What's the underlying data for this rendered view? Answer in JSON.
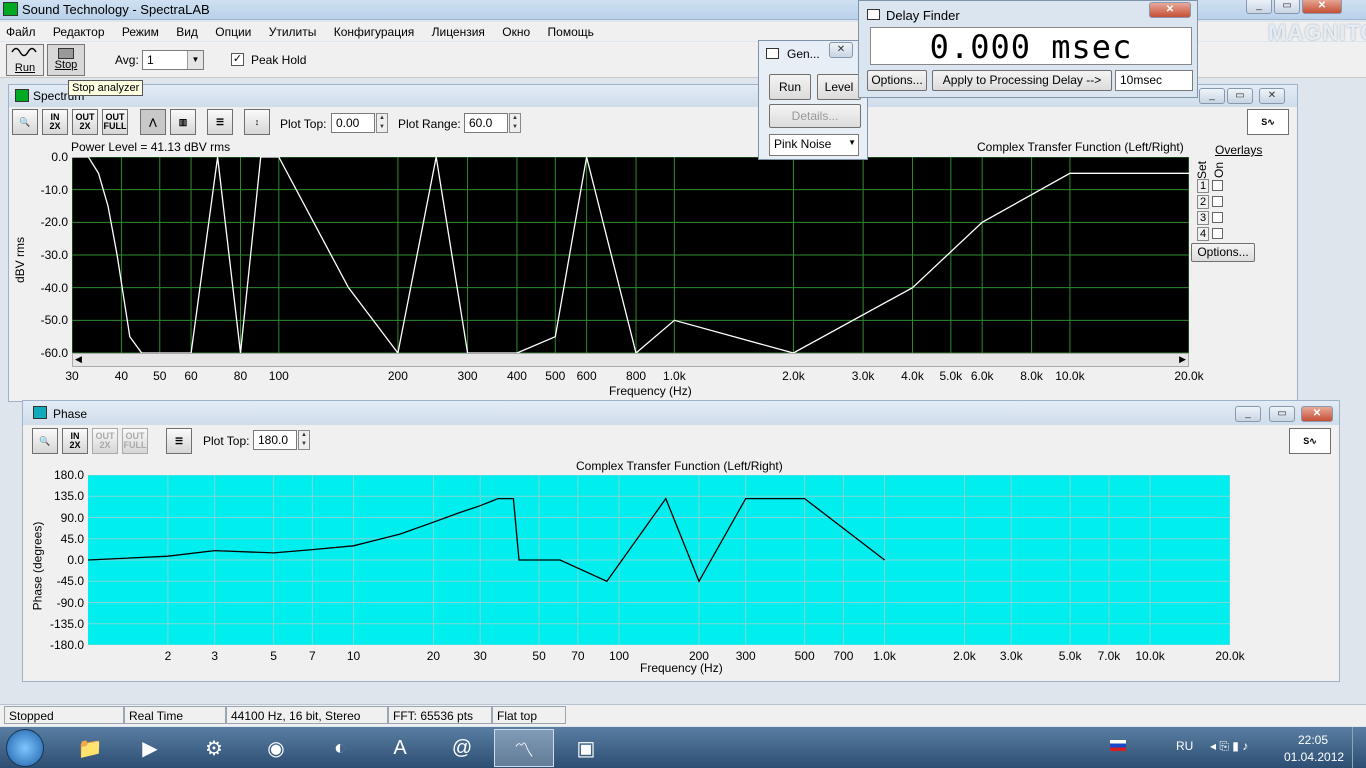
{
  "app": {
    "title": "Sound Technology - SpectraLAB",
    "menu": [
      "Файл",
      "Редактор",
      "Режим",
      "Вид",
      "Опции",
      "Утилиты",
      "Конфигурация",
      "Лицензия",
      "Окно",
      "Помощь"
    ]
  },
  "toolbar": {
    "run_label": "Run",
    "stop_label": "Stop",
    "avg_label": "Avg:",
    "avg_value": "1",
    "peak_hold_label": "Peak Hold",
    "peak_hold_checked": true,
    "tooltip": "Stop analyzer"
  },
  "spectrum": {
    "title": "Spectrum",
    "plot_top_label": "Plot Top:",
    "plot_top_value": "0.00",
    "plot_range_label": "Plot Range:",
    "plot_range_value": "60.0",
    "power_level": "Power Level = 41.13 dBV rms",
    "chart_title": "Complex Transfer Function (Left/Right)",
    "ylabel": "dBV rms",
    "xlabel": "Frequency (Hz)",
    "overlays_label": "Overlays",
    "overlay_set_label": "Set",
    "overlay_on_label": "On",
    "overlay_numbers": [
      "1",
      "2",
      "3",
      "4"
    ],
    "options_label": "Options..."
  },
  "phase": {
    "title": "Phase",
    "plot_top_label": "Plot Top:",
    "plot_top_value": "180.0",
    "chart_title": "Complex Transfer Function (Left/Right)",
    "ylabel": "Phase (degrees)",
    "xlabel": "Frequency (Hz)"
  },
  "generator": {
    "title": "Gen...",
    "run_label": "Run",
    "level_label": "Level",
    "details_label": "Details...",
    "signal": "Pink Noise"
  },
  "delay_finder": {
    "title": "Delay Finder",
    "readout": "0.000 msec",
    "options_label": "Options...",
    "apply_label": "Apply to Processing Delay -->",
    "delay_value": "10msec"
  },
  "watermark": "MAGNITOLA",
  "status": [
    "Stopped",
    "Real Time",
    "44100 Hz, 16 bit, Stereo",
    "FFT: 65536 pts",
    "Flat top"
  ],
  "taskbar": {
    "language": "RU",
    "time": "22:05",
    "date": "01.04.2012",
    "items": [
      "start",
      "explorer",
      "media-player",
      "control-panel",
      "chrome",
      "app-circle",
      "acrobat",
      "mail-agent",
      "spectralab",
      "image-viewer"
    ]
  },
  "colors": {
    "spectrum_bg": "#000000",
    "spectrum_grid": "#2e8b2e",
    "spectrum_trace": "#ffffff",
    "phase_bg": "#00eeee",
    "phase_trace": "#000000"
  },
  "chart_data": [
    {
      "type": "line",
      "title": "Complex Transfer Function (Left/Right)",
      "ylabel": "dBV rms",
      "xlabel": "Frequency (Hz)",
      "xscale": "log",
      "xlim": [
        30,
        20000
      ],
      "ylim": [
        -60,
        0
      ],
      "grid": true,
      "yticks": [
        "0.0",
        "-10.0",
        "-20.0",
        "-30.0",
        "-40.0",
        "-50.0",
        "-60.0"
      ],
      "xticks": [
        "30",
        "40",
        "50",
        "60",
        "80",
        "100",
        "200",
        "300",
        "400",
        "500",
        "600",
        "800",
        "1.0k",
        "2.0k",
        "3.0k",
        "4.0k",
        "5.0k",
        "6.0k",
        "8.0k",
        "10.0k",
        "20.0k"
      ],
      "x": [
        30,
        33,
        35,
        37,
        39,
        42,
        45,
        50,
        55,
        60,
        70,
        80,
        90,
        100,
        150,
        200,
        250,
        300,
        400,
        500,
        600,
        800,
        1000,
        2000,
        4000,
        6000,
        10000,
        20000
      ],
      "y": [
        0,
        0,
        -5,
        -15,
        -30,
        -55,
        -60,
        -60,
        -60,
        -60,
        0,
        -60,
        0,
        0,
        -40,
        -60,
        0,
        -60,
        -60,
        -55,
        0,
        -60,
        -50,
        -60,
        -40,
        -20,
        -5,
        -5
      ]
    },
    {
      "type": "line",
      "title": "Complex Transfer Function (Left/Right)",
      "ylabel": "Phase (degrees)",
      "xlabel": "Frequency (Hz)",
      "xscale": "log",
      "xlim": [
        1,
        20000
      ],
      "ylim": [
        -180,
        180
      ],
      "grid": true,
      "yticks": [
        "180.0",
        "135.0",
        "90.0",
        "45.0",
        "0.0",
        "-45.0",
        "-90.0",
        "-135.0",
        "-180.0"
      ],
      "xticks": [
        "2",
        "3",
        "5",
        "7",
        "10",
        "20",
        "30",
        "50",
        "70",
        "100",
        "200",
        "300",
        "500",
        "700",
        "1.0k",
        "2.0k",
        "3.0k",
        "5.0k",
        "7.0k",
        "10.0k",
        "20.0k"
      ],
      "x": [
        1,
        2,
        3,
        5,
        7,
        10,
        15,
        20,
        25,
        30,
        35,
        40,
        42,
        45,
        60,
        90,
        150,
        200,
        300,
        500,
        1000
      ],
      "y": [
        0,
        8,
        20,
        15,
        22,
        30,
        55,
        80,
        100,
        115,
        130,
        130,
        0,
        0,
        0,
        -45,
        130,
        -45,
        130,
        130,
        0
      ]
    }
  ]
}
